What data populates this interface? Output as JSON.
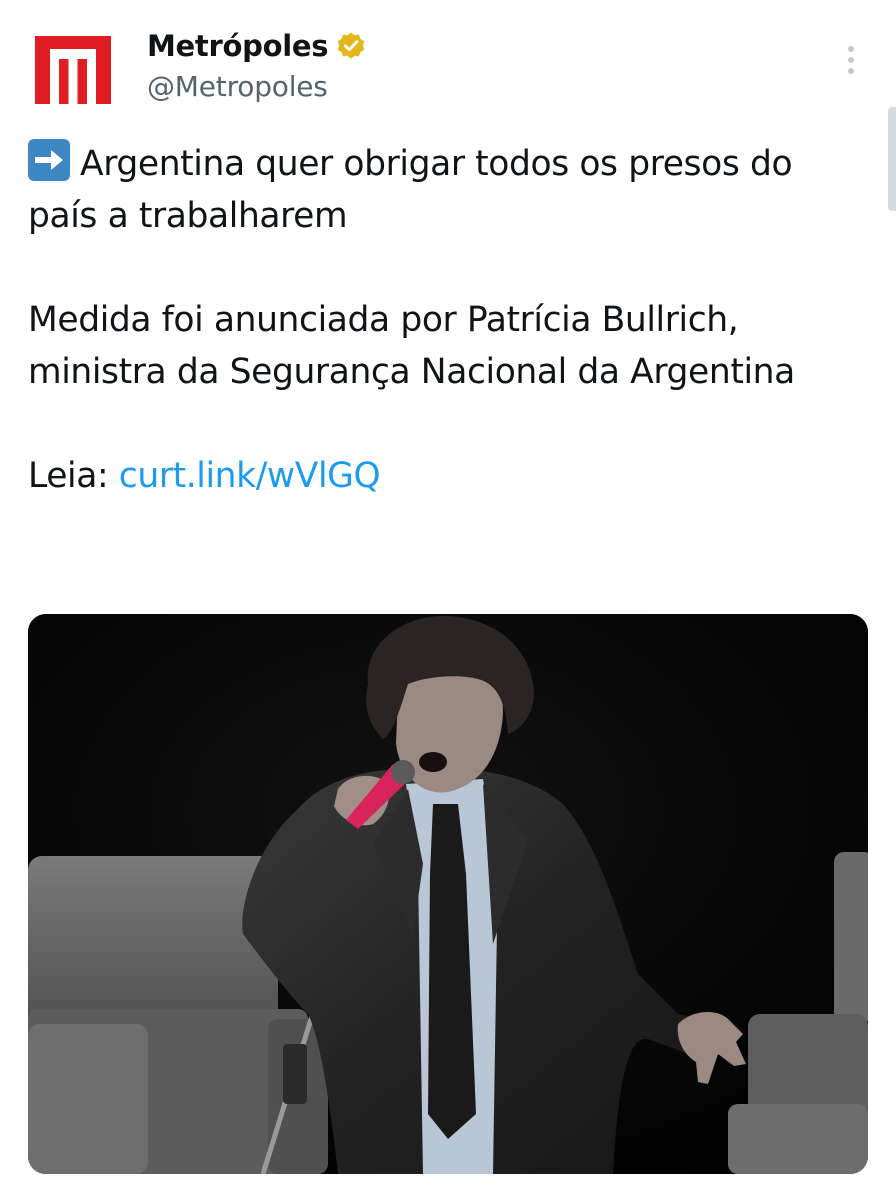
{
  "author": {
    "name": "Metrópoles",
    "handle": "@Metropoles",
    "verified": true,
    "logo_color": "#e11d24",
    "verified_color": "#e2b719"
  },
  "icons": {
    "logo": "metropoles-m-logo",
    "verified": "verified-badge-icon",
    "more": "more-vertical-icon",
    "arrow": "right-arrow-emoji"
  },
  "tweet": {
    "line1": "Argentina quer obrigar todos os presos do país a trabalharem",
    "line2": "Medida foi anunciada por Patrícia Bullrich, ministra da Segurança Nacional da Argentina",
    "leia_label": "Leia:",
    "link_text": "curt.link/wVlGQ",
    "link_color": "#1d9bf0"
  },
  "media": {
    "kind": "photo"
  }
}
